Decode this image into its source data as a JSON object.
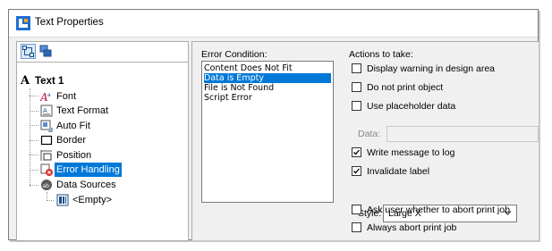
{
  "window": {
    "title": "Text Properties"
  },
  "tree": {
    "root": "Text 1",
    "items": [
      "Font",
      "Text Format",
      "Auto Fit",
      "Border",
      "Position",
      "Error Handling",
      "Data Sources"
    ],
    "sub_item": "<Empty>",
    "selected": "Error Handling"
  },
  "error_condition": {
    "label": "Error Condition:",
    "options": [
      "Content Does Not Fit",
      "Data is Empty",
      "File is Not Found",
      "Script Error"
    ],
    "selected": "Data is Empty"
  },
  "actions": {
    "label": "Actions to take:",
    "display_warning": {
      "label": "Display warning in design area",
      "checked": false
    },
    "do_not_print": {
      "label": "Do not print object",
      "checked": false
    },
    "use_placeholder": {
      "label": "Use placeholder data",
      "checked": false
    },
    "data_label": "Data:",
    "data_value": "",
    "write_message": {
      "label": "Write message to log",
      "checked": true
    },
    "invalidate_label": {
      "label": "Invalidate label",
      "checked": true
    },
    "style_label": "Style:",
    "style_value": "Large X",
    "ask_user": {
      "label": "Ask user whether to abort print job",
      "checked": false
    },
    "always_abort": {
      "label": "Always abort print job",
      "checked": false
    }
  },
  "colors": {
    "selection": "#0078d7",
    "accent_blue": "#1f6fd1",
    "accent_orange": "#f5a623"
  }
}
